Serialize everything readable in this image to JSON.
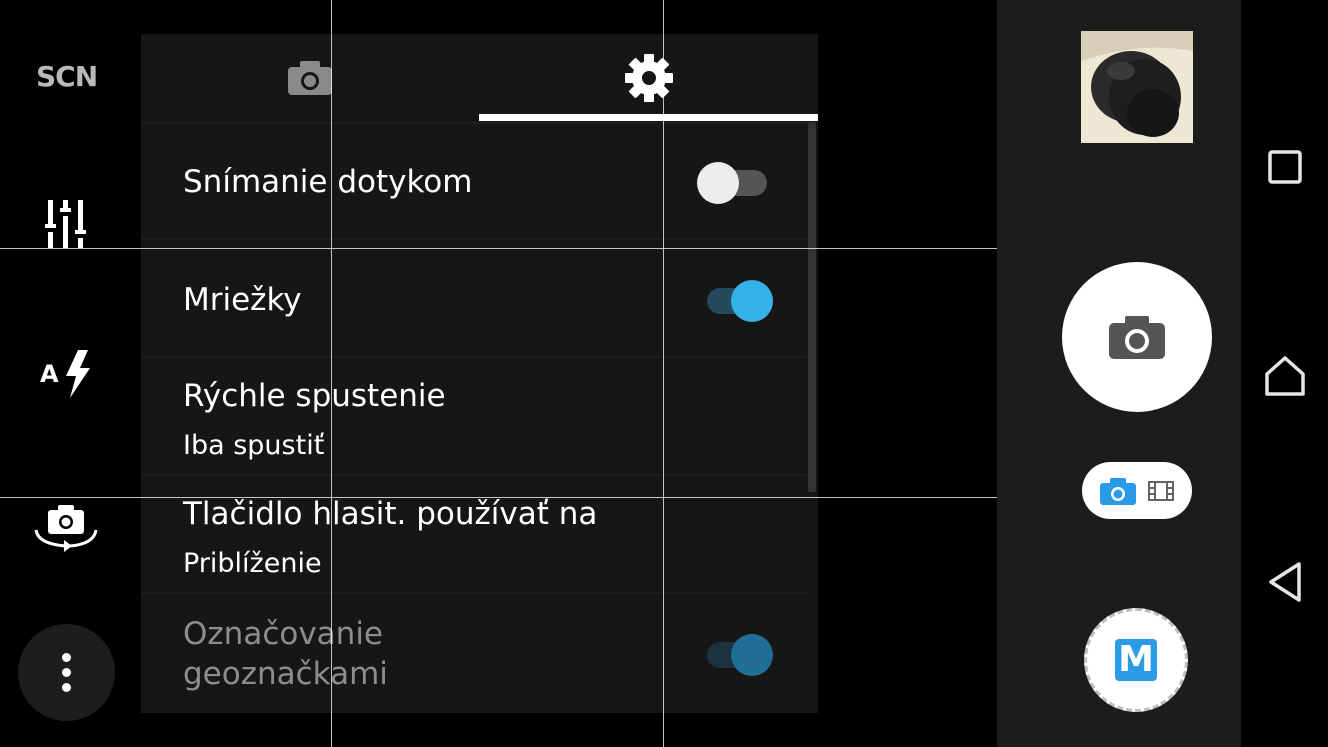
{
  "left_toolbar": {
    "scene_label": "SCN",
    "icons": [
      "sliders-icon",
      "auto-flash-icon",
      "switch-camera-icon",
      "more-options-icon"
    ],
    "flash_letter": "A"
  },
  "settings_panel": {
    "tabs": [
      {
        "icon": "camera-icon",
        "selected": false
      },
      {
        "icon": "gear-icon",
        "selected": true
      }
    ],
    "rows": [
      {
        "title": "Snímanie dotykom",
        "toggle": "off"
      },
      {
        "title": "Mriežky",
        "toggle": "on"
      },
      {
        "title": "Rýchle spustenie",
        "value": "Iba spustiť"
      },
      {
        "title": "Tlačidlo hlasit. používať na",
        "value": "Priblíženie"
      },
      {
        "title": "Označovanie geoznačkami",
        "title_line1": "Označovanie",
        "title_line2": "geoznačkami",
        "toggle": "on",
        "disabled": true
      }
    ]
  },
  "right_controls": {
    "thumbnail": "last-photo-thumbnail",
    "shutter_icon": "camera-icon",
    "mode_switch": {
      "photo_icon": "camera-icon",
      "video_icon": "film-icon",
      "selected": "photo"
    },
    "manual_mode_label": "M",
    "colors": {
      "accent": "#33b2e8",
      "manual_badge": "#2a9be8"
    }
  },
  "nav_bar": {
    "buttons": [
      "recent-apps-icon",
      "home-icon",
      "back-icon"
    ]
  }
}
